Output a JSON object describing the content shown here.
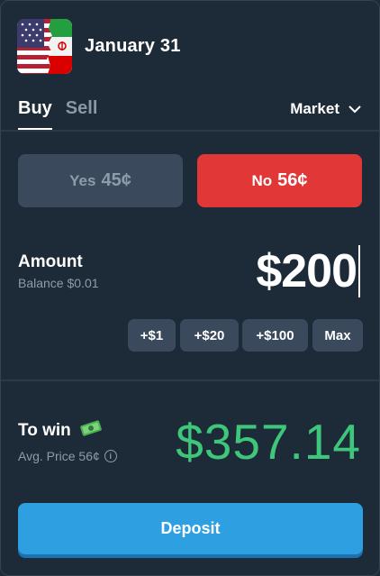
{
  "header": {
    "title": "January 31",
    "flag_icon": "usa-iran-flag-icon"
  },
  "tabs": [
    {
      "label": "Buy"
    },
    {
      "label": "Sell"
    }
  ],
  "order_type": {
    "label": "Market"
  },
  "outcomes": {
    "yes": {
      "label": "Yes",
      "price": "45¢"
    },
    "no": {
      "label": "No",
      "price": "56¢"
    }
  },
  "amount": {
    "label": "Amount",
    "balance": "Balance $0.01",
    "value": "$200"
  },
  "quick_add": [
    {
      "label": "+$1"
    },
    {
      "label": "+$20"
    },
    {
      "label": "+$100"
    },
    {
      "label": "Max"
    }
  ],
  "to_win": {
    "label": "To win",
    "avg_price": "Avg. Price 56¢",
    "value": "$357.14",
    "money_icon": "money-icon"
  },
  "deposit": {
    "label": "Deposit"
  },
  "colors": {
    "background": "#1d2b39",
    "no": "#e13737",
    "win": "#3ec77a",
    "deposit": "#2e9fe0"
  }
}
